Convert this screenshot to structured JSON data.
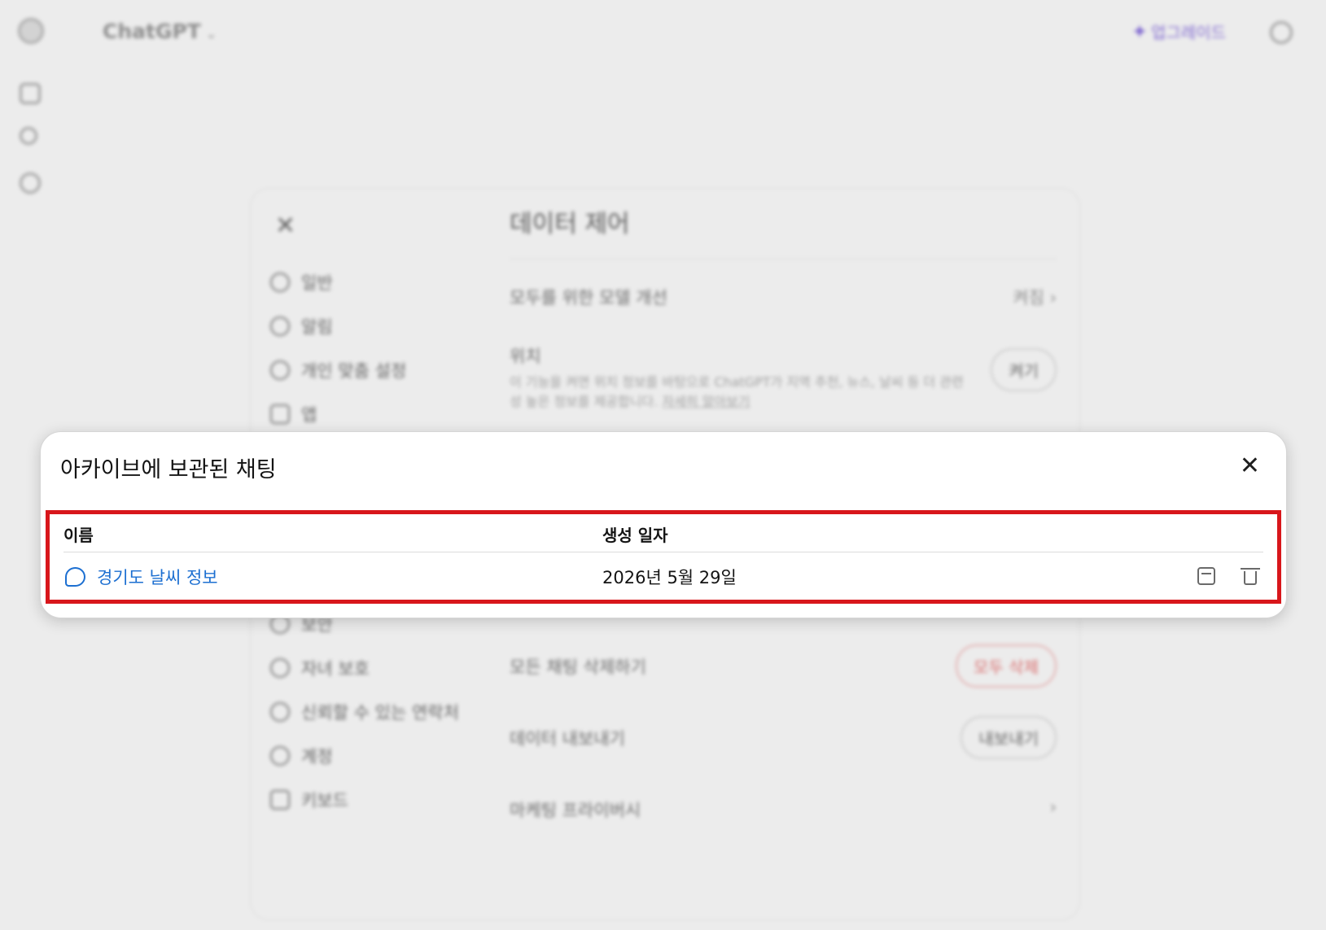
{
  "app": {
    "title": "ChatGPT",
    "chevron": "⌄",
    "upgrade_label": "업그레이드",
    "upgrade_icon": "✦"
  },
  "settings": {
    "close": "✕",
    "title": "데이터 제어",
    "nav_top": [
      {
        "label": "일반",
        "icon": "gear-icon"
      },
      {
        "label": "알림",
        "icon": "bell-icon"
      },
      {
        "label": "개인 맞춤 설정",
        "icon": "personalize-icon"
      },
      {
        "label": "앱",
        "icon": "apps-icon"
      }
    ],
    "nav_bottom": [
      {
        "label": "보안",
        "icon": "security-icon"
      },
      {
        "label": "자녀 보호",
        "icon": "parent-icon"
      },
      {
        "label": "신뢰할 수 있는 연락처",
        "icon": "lifebuoy-icon"
      },
      {
        "label": "계정",
        "icon": "account-icon"
      },
      {
        "label": "키보드",
        "icon": "keyboard-icon"
      }
    ],
    "rows": {
      "improve_model": {
        "label": "모두를 위한 모델 개선",
        "value": "켜짐",
        "chevron": "›"
      },
      "location": {
        "label": "위치",
        "desc": "이 기능을 켜면 위치 정보를 바탕으로 ChatGPT가 지역 추천, 뉴스, 날씨 등 더 관련성 높은 정보를 제공합니다.",
        "link": "자세히 알아보기",
        "button": "켜기"
      },
      "delete_all": {
        "label": "모든 채팅 삭제하기",
        "button": "모두 삭제"
      },
      "export": {
        "label": "데이터 내보내기",
        "button": "내보내기"
      },
      "marketing": {
        "label": "마케팅 프라이버시",
        "chevron": "›"
      }
    }
  },
  "archive_dialog": {
    "title": "아카이브에 보관된 채팅",
    "close": "✕",
    "columns": {
      "name": "이름",
      "created": "생성 일자"
    },
    "rows": [
      {
        "name": "경기도 날씨 정보",
        "created": "2026년 5월 29일"
      }
    ],
    "colors": {
      "link": "#1c6fd1",
      "highlight_frame": "#d8161b"
    }
  }
}
